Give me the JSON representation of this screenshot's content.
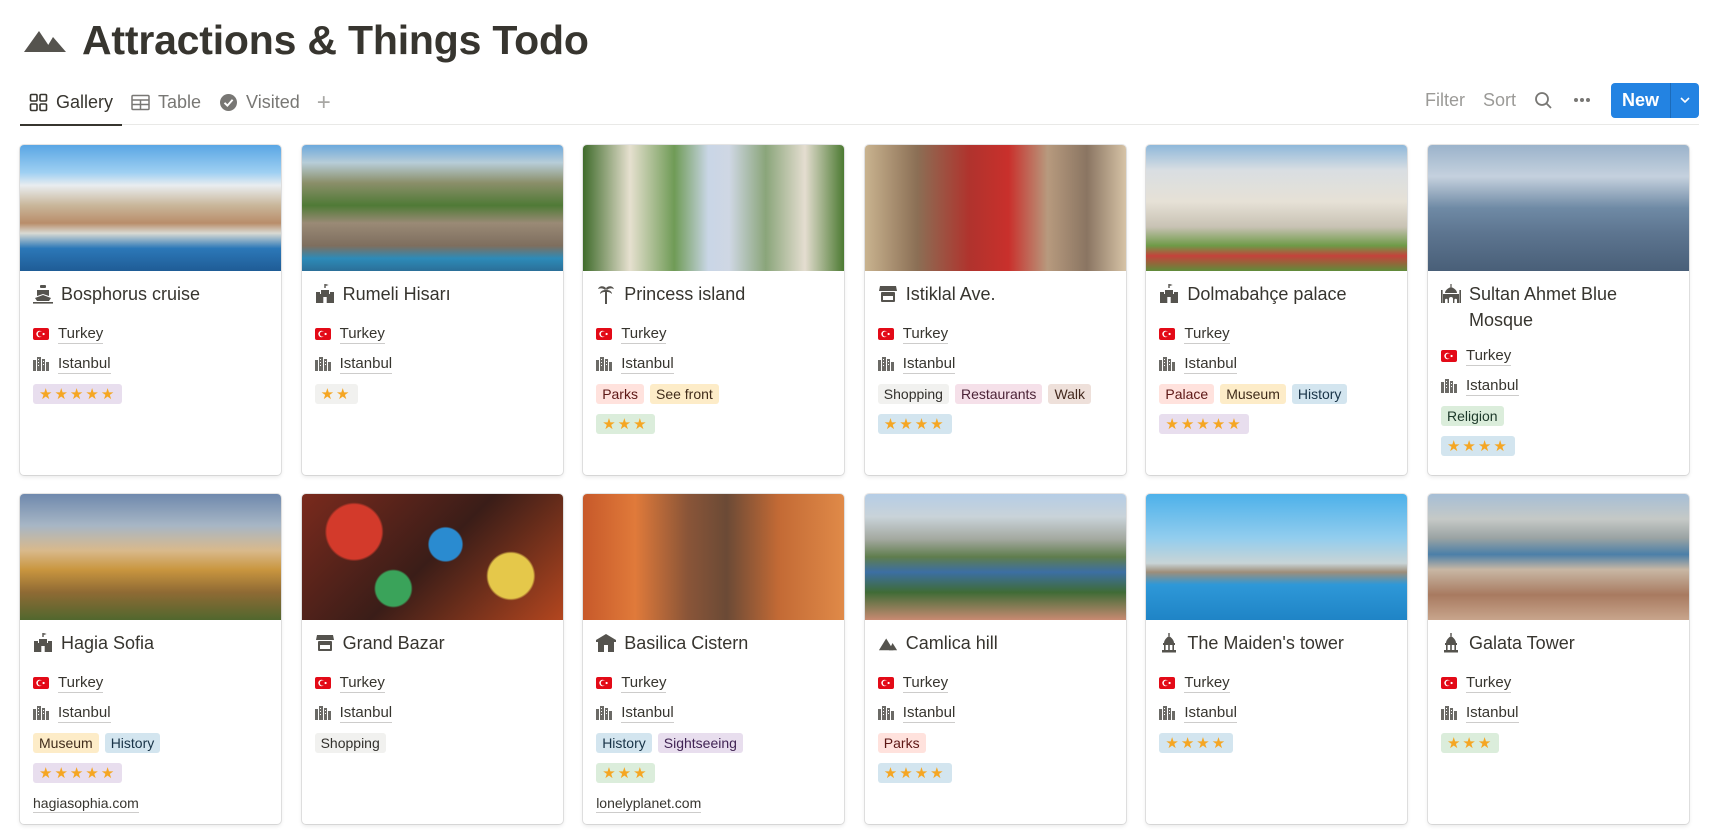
{
  "page": {
    "title": "Attractions & Things Todo",
    "icon": "mountain-icon"
  },
  "views": {
    "tabs": [
      {
        "label": "Gallery",
        "icon": "gallery-grid-icon",
        "active": true
      },
      {
        "label": "Table",
        "icon": "table-icon",
        "active": false
      },
      {
        "label": "Visited",
        "icon": "check-circle-icon",
        "active": false
      }
    ],
    "add_view_label": "+"
  },
  "toolbar": {
    "filter_label": "Filter",
    "sort_label": "Sort",
    "search_icon": "search-icon",
    "more_icon": "more-horizontal-icon",
    "new_label": "New",
    "new_caret_icon": "chevron-down-icon",
    "accent_color": "#2383e2"
  },
  "tag_colors": {
    "Parks": "red",
    "See front": "yellow",
    "Shopping": "gray",
    "Restaurants": "pink",
    "Walk": "brown",
    "Palace": "red",
    "Museum": "yellow",
    "History": "blue",
    "Religion": "green",
    "Sightseeing": "purple"
  },
  "rating_colors": {
    "2": "gray",
    "3": "green",
    "4": "blue",
    "5": "purple"
  },
  "cards": [
    {
      "title": "Bosphorus cruise",
      "icon": "ferry-icon",
      "country": "Turkey",
      "city": "Istanbul",
      "tags": [],
      "rating": 5,
      "url": "",
      "cover": "bosphorus"
    },
    {
      "title": "Rumeli Hisarı",
      "icon": "castle-icon",
      "country": "Turkey",
      "city": "Istanbul",
      "tags": [],
      "rating": 2,
      "url": "",
      "cover": "rumeli"
    },
    {
      "title": "Princess island",
      "icon": "palm-tree-icon",
      "country": "Turkey",
      "city": "Istanbul",
      "tags": [
        "Parks",
        "See front"
      ],
      "rating": 3,
      "url": "",
      "cover": "princess"
    },
    {
      "title": "Istiklal Ave.",
      "icon": "storefront-icon",
      "country": "Turkey",
      "city": "Istanbul",
      "tags": [
        "Shopping",
        "Restaurants",
        "Walk"
      ],
      "rating": 4,
      "url": "",
      "cover": "istiklal"
    },
    {
      "title": "Dolmabahçe palace",
      "icon": "castle-icon",
      "country": "Turkey",
      "city": "Istanbul",
      "tags": [
        "Palace",
        "Museum",
        "History"
      ],
      "rating": 5,
      "url": "",
      "cover": "dolmabahce"
    },
    {
      "title": "Sultan Ahmet Blue Mosque",
      "icon": "mosque-icon",
      "country": "Turkey",
      "city": "Istanbul",
      "tags": [
        "Religion"
      ],
      "rating": 4,
      "url": "",
      "cover": "bluemosque"
    },
    {
      "title": "Hagia Sofia",
      "icon": "castle-icon",
      "country": "Turkey",
      "city": "Istanbul",
      "tags": [
        "Museum",
        "History"
      ],
      "rating": 5,
      "url": "hagiasophia.com",
      "cover": "hagia"
    },
    {
      "title": "Grand Bazar",
      "icon": "storefront-icon",
      "country": "Turkey",
      "city": "Istanbul",
      "tags": [
        "Shopping"
      ],
      "rating": 0,
      "url": "",
      "cover": "bazar"
    },
    {
      "title": "Basilica Cistern",
      "icon": "temple-icon",
      "country": "Turkey",
      "city": "Istanbul",
      "tags": [
        "History",
        "Sightseeing"
      ],
      "rating": 3,
      "url": "lonelyplanet.com",
      "cover": "cistern"
    },
    {
      "title": "Camlica hill",
      "icon": "mountain-icon",
      "country": "Turkey",
      "city": "Istanbul",
      "tags": [
        "Parks"
      ],
      "rating": 4,
      "url": "",
      "cover": "camlica"
    },
    {
      "title": "The Maiden's tower",
      "icon": "tower-icon",
      "country": "Turkey",
      "city": "Istanbul",
      "tags": [],
      "rating": 4,
      "url": "",
      "cover": "maiden"
    },
    {
      "title": "Galata Tower",
      "icon": "tower-icon",
      "country": "Turkey",
      "city": "Istanbul",
      "tags": [],
      "rating": 3,
      "url": "",
      "cover": "galata"
    }
  ]
}
